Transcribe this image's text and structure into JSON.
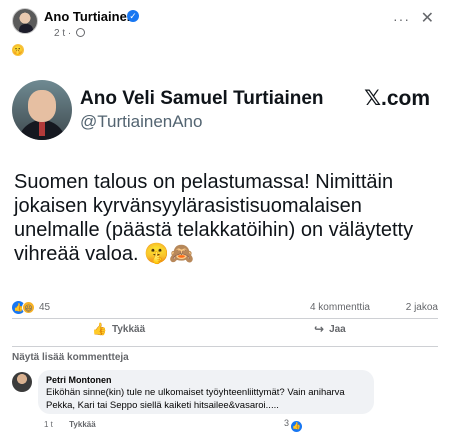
{
  "post": {
    "author": "Ano Turtiainen",
    "time": "2 t",
    "separator": "·",
    "emoji": "🤫",
    "more": "···",
    "close": "✕"
  },
  "tweet": {
    "name": "Ano Veli Samuel Turtiainen",
    "handle": "@TurtiainenAno",
    "logo": "𝕏.com",
    "text": "Suomen talous on pelastumassa! Nimittäin jokaisen kyrvänsyylärasistisuomalaisen unelmalle (päästä telakkatöihin) on väläytetty vihreää valoa. 🤫🙈"
  },
  "stats": {
    "reaction_count": "45",
    "comments": "4 kommenttia",
    "shares": "2 jakoa"
  },
  "actions": {
    "like": "Tykkää",
    "share": "Jaa"
  },
  "comments": {
    "more_label": "Näytä lisää kommentteja",
    "items": [
      {
        "author": "Petri Montonen",
        "text": "Eiköhän sinne(kin) tule ne ulkomaiset työyhteenliittymät? Vain aniharva Pekka, Kari tai Seppo siellä kaiketi hitsailee&vasaroi.....",
        "time": "1 t",
        "like_label": "Tykkää",
        "reactions": "3"
      }
    ]
  },
  "colors": {
    "accent": "#1877f2",
    "muted": "#65676b",
    "bubble": "#f0f2f5"
  }
}
